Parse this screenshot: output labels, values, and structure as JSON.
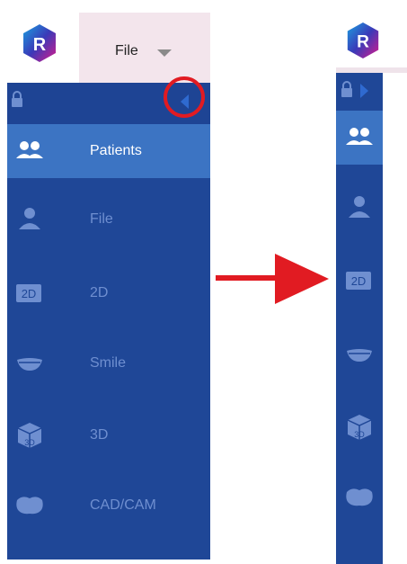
{
  "header": {
    "file_menu_label": "File"
  },
  "sidebar": {
    "items": [
      {
        "label": "Patients",
        "icon": "patients-icon",
        "active": true
      },
      {
        "label": "File",
        "icon": "person-icon",
        "active": false
      },
      {
        "label": "2D",
        "icon": "2d-icon",
        "active": false
      },
      {
        "label": "Smile",
        "icon": "smile-icon",
        "active": false
      },
      {
        "label": "3D",
        "icon": "3d-cube-icon",
        "active": false
      },
      {
        "label": "CAD/CAM",
        "icon": "tooth-icon",
        "active": false
      }
    ]
  },
  "icons": {
    "logo_letter": "R",
    "two_d_badge": "2D",
    "three_d_glyph": "3D"
  },
  "colors": {
    "sidebar_bg": "#1f4797",
    "active_bg": "#3c74c3",
    "dim_text": "#6f8fd0",
    "highlight": "#e11b22",
    "file_menu_bg": "#f3e5ec"
  }
}
